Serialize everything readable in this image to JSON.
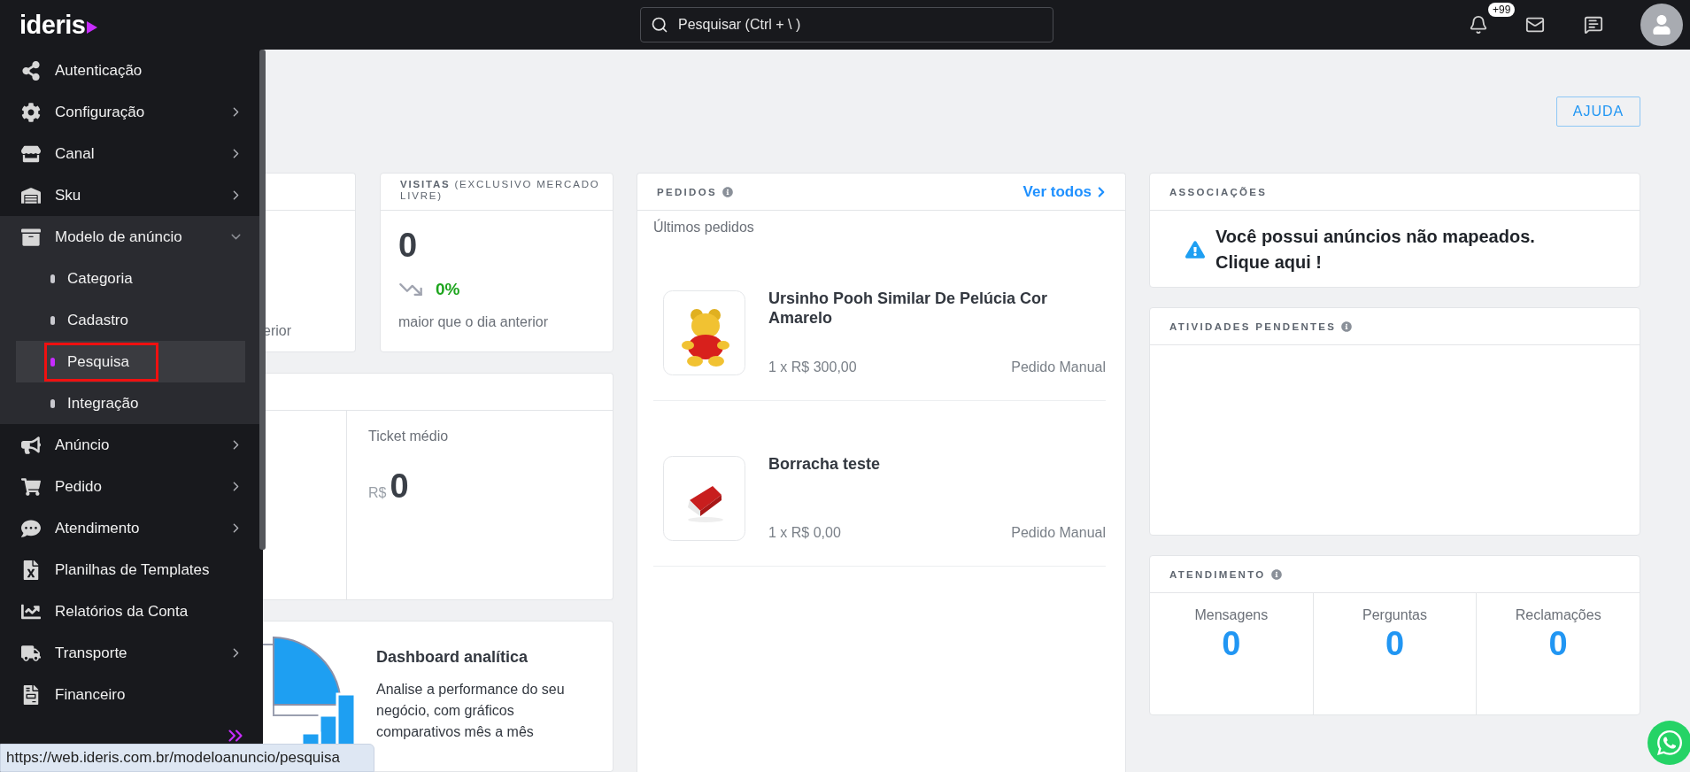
{
  "topbar": {
    "logo": "ideris",
    "search": {
      "placeholder": "Pesquisar (Ctrl + \\ )"
    },
    "notifications_badge": "+99"
  },
  "sidebar": {
    "items": [
      {
        "label": "Autenticação",
        "kind": "link"
      },
      {
        "label": "Configuração",
        "kind": "group",
        "expanded": false
      },
      {
        "label": "Canal",
        "kind": "group",
        "expanded": false
      },
      {
        "label": "Sku",
        "kind": "group",
        "expanded": false
      },
      {
        "label": "Modelo de anúncio",
        "kind": "group",
        "expanded": true,
        "children": [
          {
            "label": "Categoria",
            "selected": false,
            "highlighted": false
          },
          {
            "label": "Cadastro",
            "selected": false,
            "highlighted": false
          },
          {
            "label": "Pesquisa",
            "selected": true,
            "highlighted": true
          },
          {
            "label": "Integração",
            "selected": false,
            "highlighted": false
          }
        ]
      },
      {
        "label": "Anúncio",
        "kind": "group",
        "expanded": false
      },
      {
        "label": "Pedido",
        "kind": "group",
        "expanded": false
      },
      {
        "label": "Atendimento",
        "kind": "group",
        "expanded": false
      },
      {
        "label": "Planilhas de Templates",
        "kind": "link"
      },
      {
        "label": "Relatórios da Conta",
        "kind": "link"
      },
      {
        "label": "Transporte",
        "kind": "group",
        "expanded": false
      },
      {
        "label": "Financeiro",
        "kind": "link"
      }
    ]
  },
  "help_button": "AJUDA",
  "first_card": {
    "caption": "erior"
  },
  "visits": {
    "title": "VISITAS",
    "subtitle": "(EXCLUSIVO MERCADO LIVRE)",
    "value": "0",
    "change": "0%",
    "caption": "maior que o dia anterior"
  },
  "sales": {
    "label": "Ticket médio",
    "currency": "R$",
    "value": "0"
  },
  "dashboard_promo": {
    "title": "Dashboard analítica",
    "text": "Analise a performance do seu negócio, com gráficos comparativos mês a mês"
  },
  "orders": {
    "title": "PEDIDOS",
    "link": "Ver todos",
    "subtitle": "Últimos pedidos",
    "items": [
      {
        "name": "Ursinho Pooh Similar De Pelúcia Cor Amarelo",
        "price": "1 x R$ 300,00",
        "source": "Pedido Manual"
      },
      {
        "name": "Borracha teste",
        "price": "1 x R$ 0,00",
        "source": "Pedido Manual"
      }
    ]
  },
  "associations": {
    "title": "ASSOCIAÇÕES",
    "message": "Você possui anúncios não mapeados.",
    "link": "Clique aqui !"
  },
  "pending": {
    "title": "ATIVIDADES PENDENTES"
  },
  "support": {
    "title": "ATENDIMENTO",
    "stats": [
      {
        "label": "Mensagens",
        "value": "0"
      },
      {
        "label": "Perguntas",
        "value": "0"
      },
      {
        "label": "Reclamações",
        "value": "0"
      }
    ]
  },
  "status_bar": {
    "url": "https://web.ideris.com.br/modeloanuncio/pesquisa"
  }
}
